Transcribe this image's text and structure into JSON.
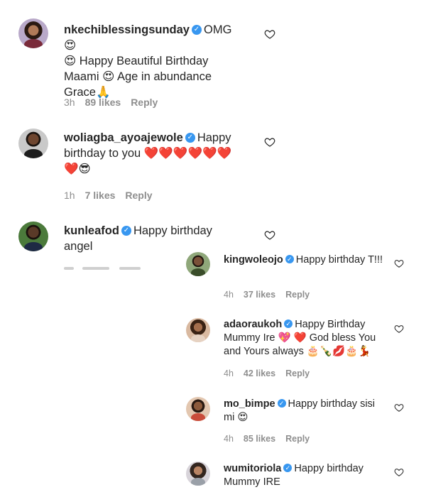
{
  "comments": [
    {
      "username": "nkechiblessingsunday",
      "parts": [
        "OMG",
        "😍",
        "😍",
        " Happy Beautiful Birthday Maami ",
        "😍",
        " Age in abundance Grace",
        "🙏"
      ],
      "time": "3h",
      "likes": "89 likes",
      "reply": "Reply"
    },
    {
      "username": "woliagba_ayoajewole",
      "parts": [
        "Happy birthday to you ",
        "❤️❤️❤️❤️❤️❤️❤️",
        "😎"
      ],
      "time": "1h",
      "likes": "7 likes",
      "reply": "Reply"
    },
    {
      "username": "kunleafod",
      "parts": [
        "Happy birthday angel"
      ]
    }
  ],
  "replies": [
    {
      "username": "kingwoleojo",
      "text": "Happy birthday T!!!",
      "time": "4h",
      "likes": "37 likes",
      "reply": "Reply"
    },
    {
      "username": "adaoraukoh",
      "text": "Happy Birthday Mummy Ire",
      "emoji1": "💖",
      "emoji2": "❤️",
      "text2": "God bless You and Yours always",
      "emoji3": "🎂🍾💋🎂💃",
      "time": "4h",
      "likes": "42 likes",
      "reply": "Reply"
    },
    {
      "username": "mo_bimpe",
      "text": "Happy birthday sisi mi",
      "emoji1": "😍",
      "time": "4h",
      "likes": "85 likes",
      "reply": "Reply"
    },
    {
      "username": "wumitoriola",
      "text": "Happy birthday Mummy IRE"
    }
  ],
  "icons": {
    "verified": "verified-badge-icon",
    "like": "heart-outline-icon"
  },
  "colors": {
    "verified": "#3897f0",
    "meta": "#8e8e8e",
    "text": "#262626"
  }
}
